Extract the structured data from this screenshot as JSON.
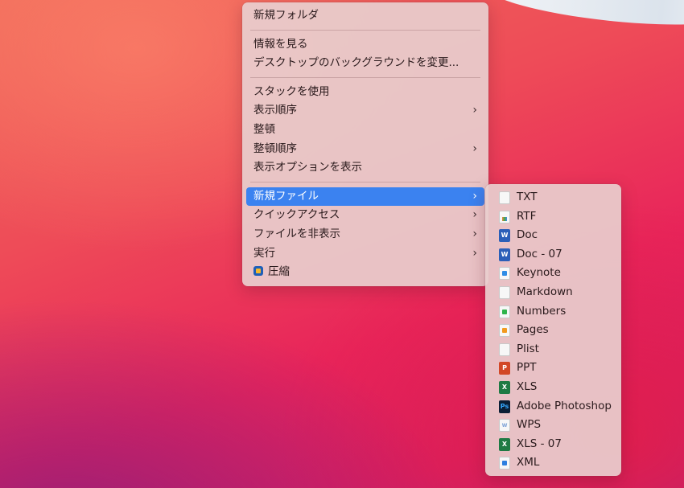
{
  "main_menu": {
    "new_folder": "新規フォルダ",
    "get_info": "情報を見る",
    "change_background": "デスクトップのバックグラウンドを変更...",
    "use_stacks": "スタックを使用",
    "sort_by": "表示順序",
    "clean_up": "整頓",
    "clean_up_by": "整頓順序",
    "show_view_options": "表示オプションを表示",
    "new_file": "新規ファイル",
    "quick_access": "クイックアクセス",
    "hide_files": "ファイルを非表示",
    "run": "実行",
    "compress": "圧縮",
    "chevron": "›"
  },
  "submenu": {
    "items": [
      {
        "label": "TXT",
        "icon": "txt-file-icon"
      },
      {
        "label": "RTF",
        "icon": "rtf-file-icon"
      },
      {
        "label": "Doc",
        "icon": "word-doc-icon"
      },
      {
        "label": "Doc - 07",
        "icon": "word-doc-icon"
      },
      {
        "label": "Keynote",
        "icon": "keynote-file-icon"
      },
      {
        "label": "Markdown",
        "icon": "markdown-file-icon"
      },
      {
        "label": "Numbers",
        "icon": "numbers-file-icon"
      },
      {
        "label": "Pages",
        "icon": "pages-file-icon"
      },
      {
        "label": "Plist",
        "icon": "plist-file-icon"
      },
      {
        "label": "PPT",
        "icon": "powerpoint-file-icon"
      },
      {
        "label": "XLS",
        "icon": "excel-file-icon"
      },
      {
        "label": "Adobe Photoshop",
        "icon": "photoshop-file-icon"
      },
      {
        "label": "WPS",
        "icon": "wps-file-icon"
      },
      {
        "label": "XLS - 07",
        "icon": "excel-file-icon"
      },
      {
        "label": "XML",
        "icon": "xml-file-icon"
      }
    ]
  },
  "colors": {
    "highlight": "#3b82f0",
    "menu_bg": "#e8cecd"
  }
}
